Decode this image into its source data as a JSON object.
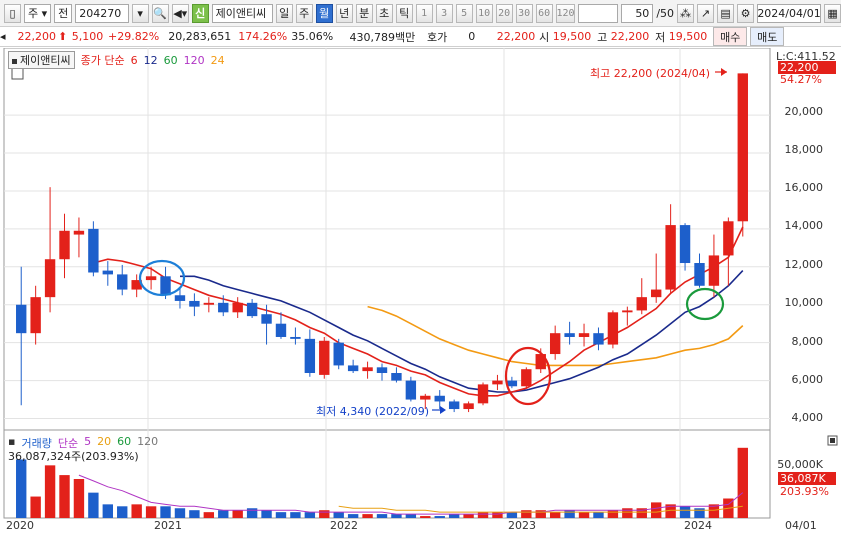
{
  "toolbar": {
    "period_label": "주",
    "type_label": "전",
    "code": "204270",
    "new_badge": "신",
    "company": "제이앤티씨",
    "periods": [
      "일",
      "주",
      "월",
      "년",
      "분",
      "초",
      "틱"
    ],
    "active_period": "월",
    "intervals": [
      "1",
      "3",
      "5",
      "10",
      "20",
      "30",
      "60",
      "120"
    ],
    "count": "50",
    "count_total": "/50",
    "date": "2024/04/01"
  },
  "infobar": {
    "price": "22,200",
    "change": "5,100",
    "change_pct": "+29.82%",
    "volume": "20,283,651",
    "vol_ratio": "174.26%",
    "turnover": "35.06%",
    "amount": "430,789백만",
    "hoga_label": "호가",
    "hoga_value": "0",
    "ask": "22,200",
    "open_label": "시",
    "open": "19,500",
    "high_label": "고",
    "high": "22,200",
    "low_label": "저",
    "low": "19,500",
    "buy_label": "매수",
    "sell_label": "매도"
  },
  "legend": {
    "name": "제이앤티씨",
    "ma_label": "종가 단순",
    "ma_periods": [
      "6",
      "12",
      "60",
      "120",
      "24"
    ]
  },
  "volume_legend": {
    "label": "거래량",
    "ma_label": "단순",
    "ma_periods": [
      "5",
      "20",
      "60",
      "120"
    ],
    "info": "36,087,324주(203.93%)"
  },
  "annotations": {
    "high": "최고 22,200 (2024/04)",
    "low": "최저 4,340 (2022/09)",
    "last_close": "L:C:411.52",
    "last_price_tag": "22,200",
    "last_pct": "54.27%",
    "last_volume_tag": "36,087K",
    "last_volume_pct": "203.93%"
  },
  "colors": {
    "up": "#e3211a",
    "down": "#1d5fcb",
    "ma6": "#e3211a",
    "ma12": "#1a2a8c",
    "ma24": "#f39a13",
    "accent_green": "#1a9a3c"
  },
  "chart_data": {
    "type": "candlestick",
    "title": "",
    "x_label": "",
    "y_label": "",
    "y_ticks": [
      "22,000",
      "20,000",
      "18,000",
      "16,000",
      "14,000",
      "12,000",
      "10,000",
      "8,000",
      "6,000",
      "4,000"
    ],
    "volume_ticks": [
      "50,000K"
    ],
    "x_ticks": [
      "2020",
      "2021",
      "2022",
      "2023",
      "2024",
      "04/01"
    ],
    "ylim": [
      3500,
      22800
    ],
    "candles": [
      {
        "o": 10000,
        "h": 12000,
        "l": 4700,
        "c": 8500
      },
      {
        "o": 8500,
        "h": 11000,
        "l": 7900,
        "c": 10400
      },
      {
        "o": 10400,
        "h": 16200,
        "l": 9600,
        "c": 12400
      },
      {
        "o": 12400,
        "h": 14800,
        "l": 11400,
        "c": 13900
      },
      {
        "o": 13700,
        "h": 14600,
        "l": 12500,
        "c": 13900
      },
      {
        "o": 14000,
        "h": 14400,
        "l": 11500,
        "c": 11700
      },
      {
        "o": 11800,
        "h": 12300,
        "l": 11000,
        "c": 11600
      },
      {
        "o": 11600,
        "h": 12100,
        "l": 10500,
        "c": 10800
      },
      {
        "o": 10800,
        "h": 11600,
        "l": 10400,
        "c": 11300
      },
      {
        "o": 11300,
        "h": 12000,
        "l": 10800,
        "c": 11500
      },
      {
        "o": 11500,
        "h": 12000,
        "l": 10300,
        "c": 10500
      },
      {
        "o": 10500,
        "h": 10900,
        "l": 9800,
        "c": 10200
      },
      {
        "o": 10200,
        "h": 10600,
        "l": 9400,
        "c": 9900
      },
      {
        "o": 10000,
        "h": 10400,
        "l": 9600,
        "c": 10100
      },
      {
        "o": 10100,
        "h": 10500,
        "l": 9400,
        "c": 9600
      },
      {
        "o": 9600,
        "h": 10400,
        "l": 9300,
        "c": 10100
      },
      {
        "o": 10100,
        "h": 10300,
        "l": 9300,
        "c": 9400
      },
      {
        "o": 9500,
        "h": 10000,
        "l": 7900,
        "c": 9000
      },
      {
        "o": 9000,
        "h": 9600,
        "l": 8200,
        "c": 8300
      },
      {
        "o": 8300,
        "h": 8800,
        "l": 7900,
        "c": 8200
      },
      {
        "o": 8200,
        "h": 8700,
        "l": 6200,
        "c": 6400
      },
      {
        "o": 6300,
        "h": 8300,
        "l": 6100,
        "c": 8100
      },
      {
        "o": 8000,
        "h": 8200,
        "l": 6600,
        "c": 6800
      },
      {
        "o": 6800,
        "h": 7100,
        "l": 6400,
        "c": 6500
      },
      {
        "o": 6500,
        "h": 7000,
        "l": 6100,
        "c": 6700
      },
      {
        "o": 6700,
        "h": 6900,
        "l": 6000,
        "c": 6400
      },
      {
        "o": 6400,
        "h": 6700,
        "l": 5900,
        "c": 6000
      },
      {
        "o": 6000,
        "h": 6200,
        "l": 4900,
        "c": 5000
      },
      {
        "o": 5000,
        "h": 5300,
        "l": 4500,
        "c": 5200
      },
      {
        "o": 5200,
        "h": 5500,
        "l": 4500,
        "c": 4900
      },
      {
        "o": 4900,
        "h": 5000,
        "l": 4340,
        "c": 4500
      },
      {
        "o": 4500,
        "h": 4900,
        "l": 4340,
        "c": 4800
      },
      {
        "o": 4800,
        "h": 5900,
        "l": 4700,
        "c": 5800
      },
      {
        "o": 5800,
        "h": 6300,
        "l": 5500,
        "c": 6000
      },
      {
        "o": 6000,
        "h": 6200,
        "l": 5600,
        "c": 5700
      },
      {
        "o": 5700,
        "h": 6700,
        "l": 5600,
        "c": 6600
      },
      {
        "o": 6600,
        "h": 7700,
        "l": 6400,
        "c": 7400
      },
      {
        "o": 7400,
        "h": 8900,
        "l": 7100,
        "c": 8500
      },
      {
        "o": 8500,
        "h": 9100,
        "l": 7900,
        "c": 8300
      },
      {
        "o": 8300,
        "h": 9000,
        "l": 7800,
        "c": 8500
      },
      {
        "o": 8500,
        "h": 8800,
        "l": 7600,
        "c": 7900
      },
      {
        "o": 7900,
        "h": 9700,
        "l": 7700,
        "c": 9600
      },
      {
        "o": 9600,
        "h": 9900,
        "l": 8900,
        "c": 9700
      },
      {
        "o": 9700,
        "h": 11400,
        "l": 9500,
        "c": 10400
      },
      {
        "o": 10400,
        "h": 12700,
        "l": 10100,
        "c": 10800
      },
      {
        "o": 10800,
        "h": 15300,
        "l": 10600,
        "c": 14200
      },
      {
        "o": 14200,
        "h": 14300,
        "l": 11800,
        "c": 12200
      },
      {
        "o": 12200,
        "h": 12700,
        "l": 10900,
        "c": 11000
      },
      {
        "o": 11000,
        "h": 13700,
        "l": 10400,
        "c": 12600
      },
      {
        "o": 12600,
        "h": 14600,
        "l": 11000,
        "c": 14400
      },
      {
        "o": 14400,
        "h": 22200,
        "l": 13600,
        "c": 22200
      }
    ],
    "ma6": [
      null,
      null,
      null,
      null,
      null,
      12200,
      12400,
      12300,
      12100,
      11900,
      11400,
      11100,
      10800,
      10500,
      10300,
      10100,
      9900,
      9700,
      9500,
      9200,
      8800,
      8500,
      8000,
      7700,
      7400,
      7000,
      6800,
      6500,
      6300,
      5900,
      5600,
      5300,
      5200,
      5200,
      5400,
      5600,
      6000,
      6500,
      7000,
      7600,
      8000,
      8400,
      8800,
      9300,
      9800,
      10600,
      11200,
      11600,
      12000,
      12500,
      14100
    ],
    "ma12": [
      null,
      null,
      null,
      null,
      null,
      null,
      null,
      null,
      null,
      null,
      null,
      11500,
      11500,
      11300,
      11000,
      10800,
      10600,
      10400,
      10200,
      9900,
      9600,
      9200,
      8800,
      8400,
      8100,
      7700,
      7300,
      6900,
      6600,
      6200,
      5900,
      5600,
      5500,
      5400,
      5400,
      5500,
      5700,
      5900,
      6100,
      6400,
      6700,
      7100,
      7400,
      7900,
      8400,
      9000,
      9600,
      9900,
      10400,
      11000,
      11800
    ],
    "ma24": [
      null,
      null,
      null,
      null,
      null,
      null,
      null,
      null,
      null,
      null,
      null,
      null,
      null,
      null,
      null,
      null,
      null,
      null,
      null,
      null,
      null,
      null,
      null,
      null,
      9900,
      9700,
      9400,
      9000,
      8600,
      8200,
      7900,
      7600,
      7400,
      7200,
      7000,
      6900,
      6800,
      6800,
      6800,
      6800,
      6800,
      6900,
      7000,
      7100,
      7200,
      7400,
      7600,
      7700,
      7900,
      8200,
      8900
    ],
    "volume": [
      30,
      11,
      27,
      22,
      20,
      13,
      7,
      6,
      7,
      6,
      6,
      5,
      4,
      3,
      4,
      4,
      5,
      4,
      3,
      3,
      3,
      4,
      3,
      2,
      2,
      2,
      2,
      2,
      1,
      1,
      2,
      2,
      3,
      3,
      3,
      4,
      4,
      3,
      4,
      3,
      3,
      4,
      5,
      5,
      8,
      7,
      6,
      5,
      7,
      10,
      36
    ],
    "volume_up": [
      false,
      true,
      true,
      true,
      true,
      false,
      false,
      false,
      true,
      true,
      false,
      false,
      false,
      true,
      false,
      true,
      false,
      false,
      false,
      false,
      false,
      true,
      false,
      false,
      true,
      false,
      false,
      false,
      true,
      false,
      false,
      true,
      true,
      true,
      false,
      true,
      true,
      true,
      false,
      true,
      false,
      true,
      true,
      true,
      true,
      true,
      false,
      false,
      true,
      true,
      true
    ],
    "vol_ma5": [
      null,
      null,
      null,
      null,
      22,
      19,
      16,
      14,
      11,
      8,
      7,
      6,
      6,
      5,
      4,
      4,
      4,
      4,
      4,
      4,
      3,
      3,
      3,
      3,
      3,
      3,
      2,
      2,
      2,
      2,
      2,
      2,
      2,
      2,
      3,
      3,
      3,
      4,
      4,
      4,
      4,
      4,
      4,
      4,
      5,
      6,
      6,
      6,
      6,
      7,
      13
    ],
    "vol_ma20": [
      null,
      null,
      null,
      null,
      null,
      null,
      null,
      null,
      null,
      null,
      null,
      null,
      null,
      null,
      null,
      null,
      null,
      null,
      null,
      null,
      null,
      null,
      6,
      5,
      5,
      5,
      4,
      4,
      4,
      3,
      3,
      3,
      3,
      3,
      3,
      3,
      3,
      3,
      3,
      3,
      3,
      3,
      3,
      3,
      3,
      4,
      4,
      4,
      4,
      5,
      6
    ]
  }
}
